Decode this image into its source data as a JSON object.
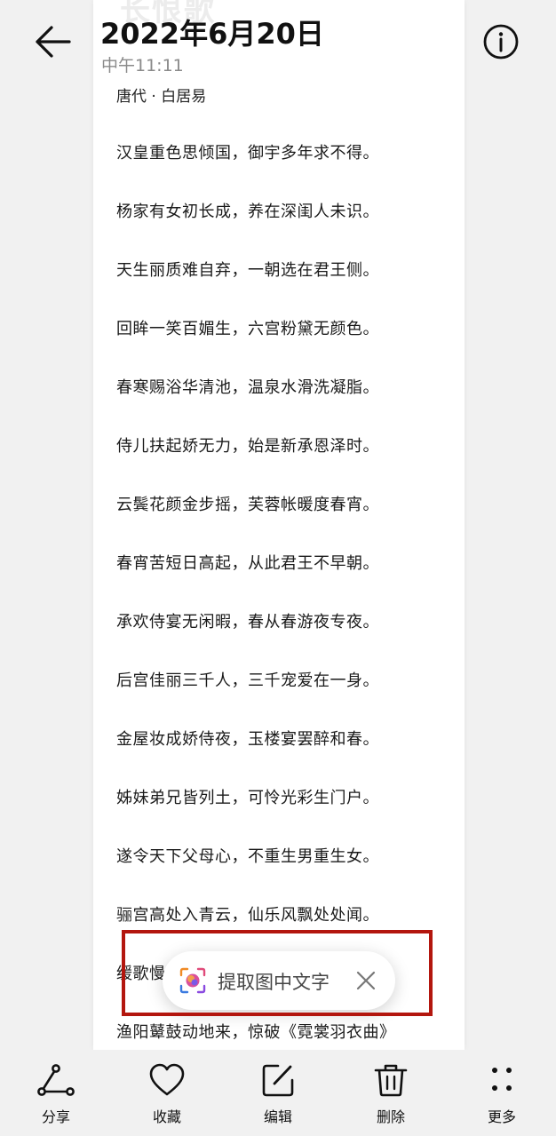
{
  "header": {
    "date": "2022年6月20日",
    "time": "中午11:11"
  },
  "photo": {
    "author": "唐代 · 白居易",
    "lines": [
      "汉皇重色思倾国，御宇多年求不得。",
      "杨家有女初长成，养在深闺人未识。",
      "天生丽质难自弃，一朝选在君王侧。",
      "回眸一笑百媚生，六宫粉黛无颜色。",
      "春寒赐浴华清池，温泉水滑洗凝脂。",
      "侍儿扶起娇无力，始是新承恩泽时。",
      "云鬓花颜金步摇，芙蓉帐暖度春宵。",
      "春宵苦短日高起，从此君王不早朝。",
      "承欢侍宴无闲暇，春从春游夜专夜。",
      "后宫佳丽三千人，三千宠爱在一身。",
      "金屋妆成娇侍夜，玉楼宴罢醉和春。",
      "姊妹弟兄皆列土，可怜光彩生门户。",
      "遂令天下父母心，不重生男重生女。",
      "骊宫高处入青云，仙乐风飘处处闻。",
      "缓歌慢",
      "渔阳鼙鼓动地来，惊破《霓裳羽衣曲》"
    ]
  },
  "ocr_prompt": {
    "label": "提取图中文字",
    "highlight_color": "#b3160e"
  },
  "toolbar": {
    "items": [
      {
        "label": "分享",
        "icon": "share-icon"
      },
      {
        "label": "收藏",
        "icon": "heart-icon"
      },
      {
        "label": "编辑",
        "icon": "edit-icon"
      },
      {
        "label": "删除",
        "icon": "trash-icon"
      },
      {
        "label": "更多",
        "icon": "more-icon"
      }
    ]
  }
}
